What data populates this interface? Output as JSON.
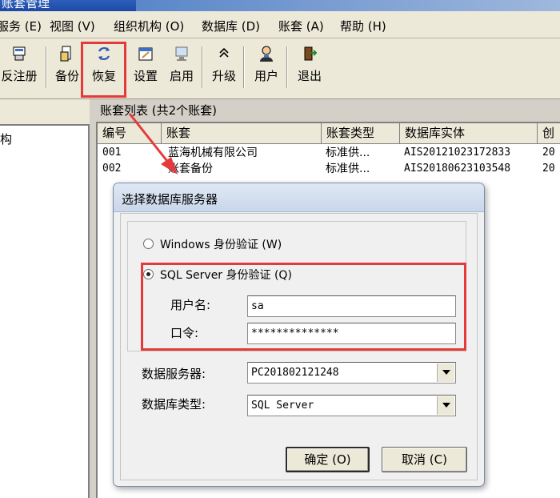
{
  "window": {
    "title": "账套管理"
  },
  "menu": [
    {
      "id": "service",
      "label": "服务 (E)"
    },
    {
      "id": "view",
      "label": "视图 (V)"
    },
    {
      "id": "org",
      "label": "组织机构 (O)"
    },
    {
      "id": "database",
      "label": "数据库 (D)"
    },
    {
      "id": "account",
      "label": "账套 (A)"
    },
    {
      "id": "help",
      "label": "帮助 (H)"
    }
  ],
  "toolbar": {
    "unregister": "反注册",
    "backup": "备份",
    "restore": "恢复",
    "settings": "设置",
    "enable": "启用",
    "upgrade": "升级",
    "user": "用户",
    "exit": "退出"
  },
  "tree": {
    "node_label": "构"
  },
  "account_list": {
    "caption": "账套列表 (共2个账套)",
    "columns": [
      "编号",
      "账套",
      "账套类型",
      "数据库实体",
      "创"
    ],
    "rows": [
      {
        "id": "001",
        "name": "蓝海机械有限公司",
        "type": "标准供...",
        "db": "AIS20121023172833",
        "created": "20"
      },
      {
        "id": "002",
        "name": "账套备份",
        "type": "标准供...",
        "db": "AIS20180623103548",
        "created": "20"
      }
    ]
  },
  "dialog": {
    "title": "选择数据库服务器",
    "windows_auth_label": "Windows 身份验证 (W)",
    "sql_auth_label": "SQL Server 身份验证 (Q)",
    "username_label": "用户名:",
    "username_value": "sa",
    "password_label": "口令:",
    "password_value": "**************",
    "server_label": "数据服务器:",
    "server_value": "PC201802121248",
    "dbtype_label": "数据库类型:",
    "dbtype_value": "SQL Server",
    "ok_label": "确定 (O)",
    "cancel_label": "取消 (C)"
  },
  "colors": {
    "highlight": "#e53a3a",
    "arrow": "#e53a3a"
  },
  "icons": [
    "unregister-icon",
    "backup-icon",
    "restore-icon",
    "settings-icon",
    "enable-icon",
    "upgrade-icon",
    "user-icon",
    "exit-icon"
  ]
}
